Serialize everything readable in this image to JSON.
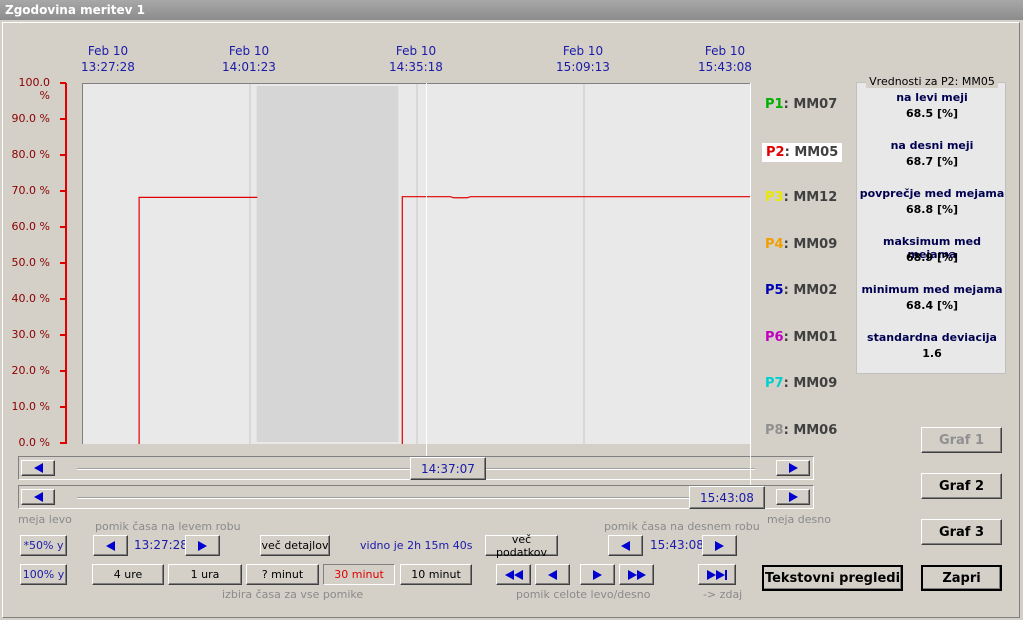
{
  "window_title": "Zgodovina meritev 1",
  "time_labels": [
    {
      "date": "Feb 10",
      "time": "13:27:28"
    },
    {
      "date": "Feb 10",
      "time": "14:01:23"
    },
    {
      "date": "Feb 10",
      "time": "14:35:18"
    },
    {
      "date": "Feb 10",
      "time": "15:09:13"
    },
    {
      "date": "Feb 10",
      "time": "15:43:08"
    }
  ],
  "y_ticks": [
    "100.0 %",
    "90.0 %",
    "80.0 %",
    "70.0 %",
    "60.0 %",
    "50.0 %",
    "40.0 %",
    "30.0 %",
    "20.0 %",
    "10.0 %",
    "0.0 %"
  ],
  "chart_data": {
    "type": "line",
    "title": "",
    "xlabel": "",
    "ylabel": "",
    "ylim": [
      0,
      100
    ],
    "x_ticks": [
      "13:27:28",
      "14:01:23",
      "14:35:18",
      "15:09:13",
      "15:43:08"
    ],
    "series": [
      {
        "name": "P2: MM05",
        "color": "#e00000",
        "segments": [
          [
            {
              "x": 0.084,
              "y": 0
            },
            {
              "x": 0.084,
              "y": 68.5
            },
            {
              "x": 0.261,
              "y": 68.5
            }
          ],
          [
            {
              "x": 0.478,
              "y": 0
            },
            {
              "x": 0.478,
              "y": 68.7
            },
            {
              "x": 0.55,
              "y": 68.7
            },
            {
              "x": 0.555,
              "y": 68.4
            },
            {
              "x": 0.575,
              "y": 68.4
            },
            {
              "x": 0.58,
              "y": 68.7
            },
            {
              "x": 1.0,
              "y": 68.7
            }
          ]
        ]
      }
    ],
    "gap_region": [
      0.26,
      0.478
    ],
    "cursor_left": "14:37:07",
    "cursor_right": "15:43:08"
  },
  "legend": [
    {
      "code": "P1",
      "name": "MM07",
      "color": "#00b000"
    },
    {
      "code": "P2",
      "name": "MM05",
      "color": "#e00000",
      "selected": true
    },
    {
      "code": "P3",
      "name": "MM12",
      "color": "#e8e800"
    },
    {
      "code": "P4",
      "name": "MM09",
      "color": "#f0a000"
    },
    {
      "code": "P5",
      "name": "MM02",
      "color": "#0000b0"
    },
    {
      "code": "P6",
      "name": "MM01",
      "color": "#c000c0"
    },
    {
      "code": "P7",
      "name": "MM09",
      "color": "#00d0d0"
    },
    {
      "code": "P8",
      "name": "MM06",
      "color": "#909090"
    }
  ],
  "values_panel": {
    "title": "Vrednosti za P2: MM05",
    "rows": [
      {
        "label": "na levi meji",
        "value": "68.5 [%]"
      },
      {
        "label": "na desni meji",
        "value": "68.7 [%]"
      },
      {
        "label": "povprečje med mejama",
        "value": "68.8 [%]"
      },
      {
        "label": "maksimum med mejama",
        "value": "68.9 [%]"
      },
      {
        "label": "minimum med mejama",
        "value": "68.4 [%]"
      },
      {
        "label": "standardna deviacija",
        "value": "1.6"
      }
    ]
  },
  "scroll": {
    "left_cursor": "14:37:07",
    "right_cursor": "15:43:08"
  },
  "labels": {
    "meja_levo": "meja levo",
    "meja_desno": "meja desno",
    "pomik_levo": "pomik časa na levem robu",
    "pomik_desno": "pomik časa na desnem robu",
    "left_time": "13:27:28",
    "right_time": "15:43:08",
    "vidno": "vidno je 2h 15m 40s",
    "izbira": "izbira časa za vse pomike",
    "pomik_celote": "pomik celote levo/desno",
    "zdaj": "-> zdaj"
  },
  "buttons": {
    "y50": "*50% y",
    "y100": "100% y",
    "vec_detajlov": "več detajlov",
    "vec_podatkov": "več podatkov",
    "t4ure": "4 ure",
    "t1ura": "1 ura",
    "tq": "? minut",
    "t30": "30 minut",
    "t10": "10 minut",
    "graf1": "Graf 1",
    "graf2": "Graf 2",
    "graf3": "Graf 3",
    "tekstovni": "Tekstovni pregledi",
    "zapri": "Zapri"
  },
  "colors": {
    "accent": "#1a1aa8",
    "line": "#e00000",
    "axis": "#e00000",
    "selected_time": "#e00000"
  }
}
